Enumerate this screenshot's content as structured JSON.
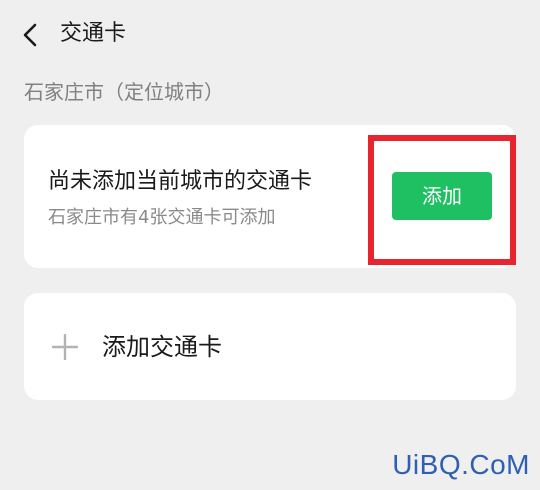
{
  "header": {
    "back_icon": "chevron-left-icon",
    "title": "交通卡"
  },
  "location_section": {
    "label": "石家庄市（定位城市）"
  },
  "city_card": {
    "title": "尚未添加当前城市的交通卡",
    "subtitle": "石家庄市有4张交通卡可添加",
    "add_button_label": "添加",
    "add_button_color": "#1ec062",
    "highlight_color": "#e8252e"
  },
  "add_card": {
    "icon": "plus-icon",
    "label": "添加交通卡"
  },
  "watermark": {
    "text": "UiBQ.CoM"
  }
}
